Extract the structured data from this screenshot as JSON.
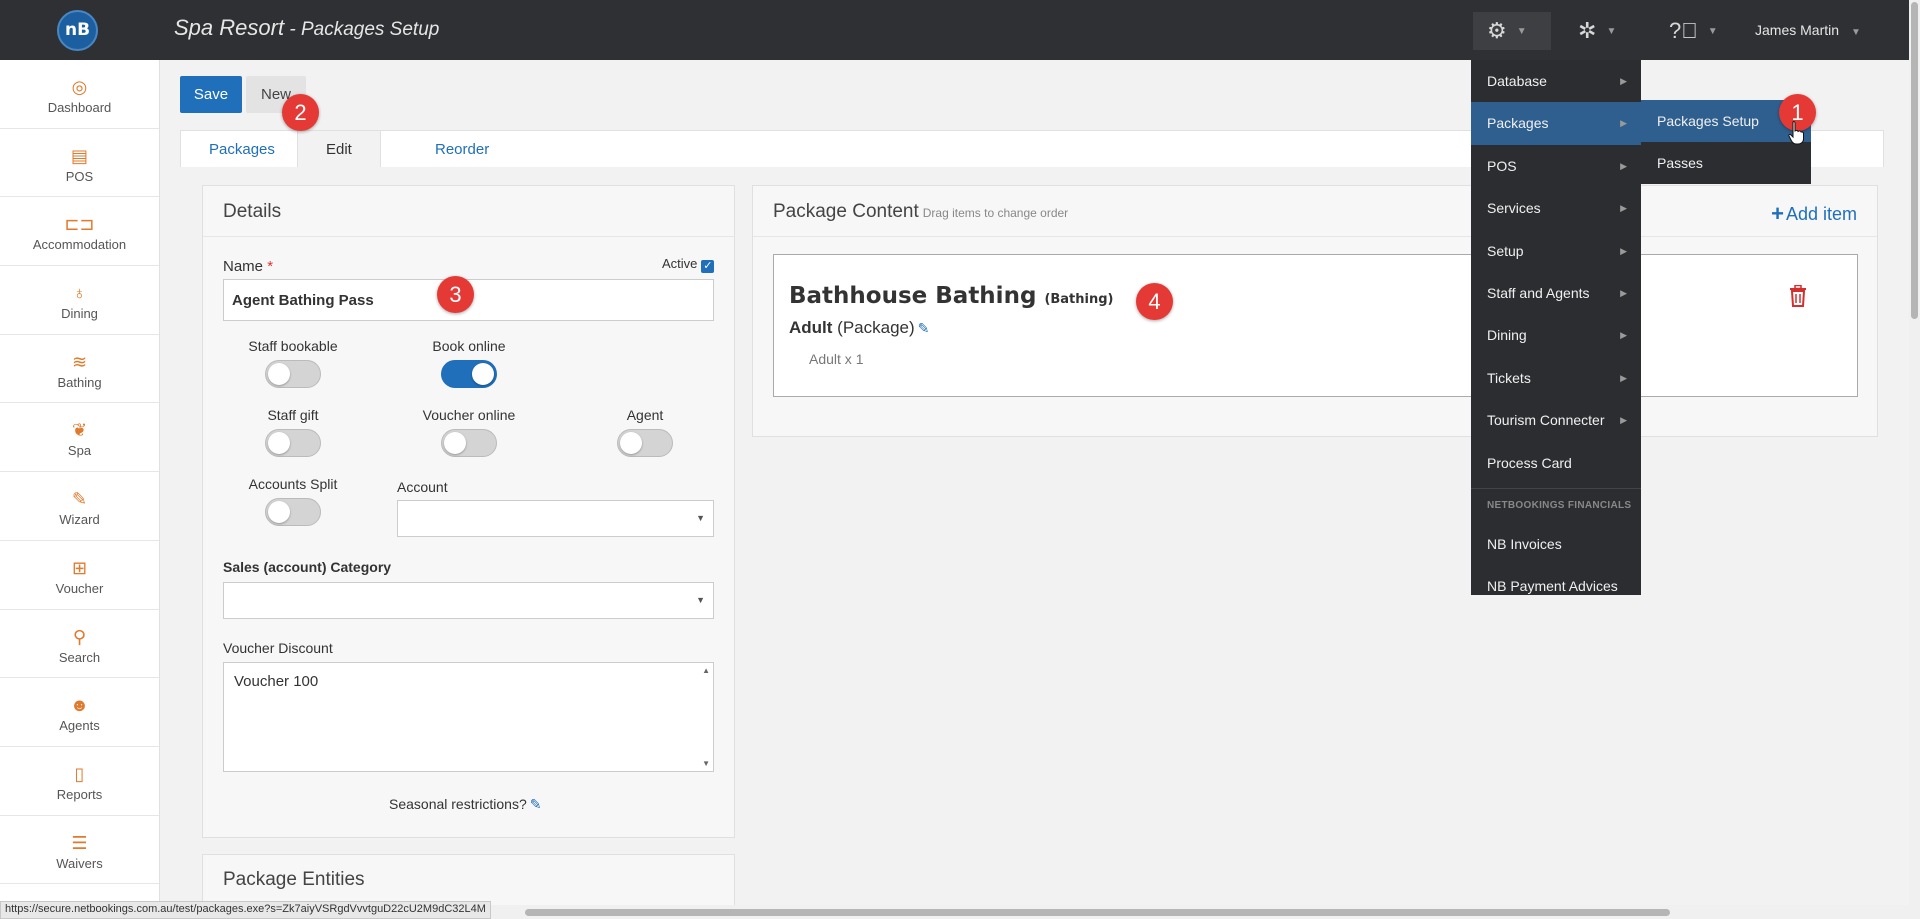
{
  "header": {
    "logo_text": "nB",
    "title_main": "Spa Resort",
    "title_sep": " - ",
    "title_sub": "Packages Setup",
    "user_name": "James Martin",
    "icons": [
      "gears-icon",
      "puzzle-icon",
      "help-circle-icon"
    ]
  },
  "sidebar": {
    "items": [
      {
        "label": "Dashboard",
        "icon": "dashboard-icon"
      },
      {
        "label": "POS",
        "icon": "pos-icon"
      },
      {
        "label": "Accommodation",
        "icon": "bed-icon"
      },
      {
        "label": "Dining",
        "icon": "dining-icon"
      },
      {
        "label": "Bathing",
        "icon": "waves-icon"
      },
      {
        "label": "Spa",
        "icon": "lotus-icon"
      },
      {
        "label": "Wizard",
        "icon": "wand-icon"
      },
      {
        "label": "Voucher",
        "icon": "gift-icon"
      },
      {
        "label": "Search",
        "icon": "search-icon"
      },
      {
        "label": "Agents",
        "icon": "agents-icon"
      },
      {
        "label": "Reports",
        "icon": "document-icon"
      },
      {
        "label": "Waivers",
        "icon": "checklist-icon"
      }
    ]
  },
  "toolbar": {
    "save_label": "Save",
    "new_label": "New"
  },
  "tabs": [
    {
      "label": "Packages"
    },
    {
      "label": "Edit"
    },
    {
      "label": "Reorder"
    }
  ],
  "details": {
    "title": "Details",
    "name_label": "Name",
    "required_mark": "*",
    "active_label": "Active",
    "active_checked": true,
    "name_value": "Agent Bathing Pass",
    "toggles": {
      "staff_bookable": {
        "label": "Staff bookable",
        "on": false
      },
      "book_online": {
        "label": "Book online",
        "on": true
      },
      "staff_gift": {
        "label": "Staff gift",
        "on": false
      },
      "voucher_online": {
        "label": "Voucher online",
        "on": false
      },
      "agent": {
        "label": "Agent",
        "on": false
      },
      "accounts_split": {
        "label": "Accounts Split",
        "on": false
      }
    },
    "account_label": "Account",
    "account_value": "",
    "sales_category_label": "Sales (account) Category",
    "sales_category_value": "",
    "voucher_discount_label": "Voucher Discount",
    "voucher_discount_value": "Voucher 100",
    "seasonal_label": "Seasonal restrictions?"
  },
  "entities": {
    "title": "Package Entities"
  },
  "package_content": {
    "title": "Package Content",
    "hint": "Drag items to change order",
    "add_item_label": "Add item",
    "item": {
      "name": "Bathhouse Bathing",
      "category": "(Bathing)",
      "type_label": "Adult",
      "type_kind": "(Package)",
      "quantity_text": "Adult x 1"
    }
  },
  "menu": {
    "items": [
      {
        "label": "Database",
        "has_sub": true
      },
      {
        "label": "Packages",
        "has_sub": true,
        "active": true
      },
      {
        "label": "POS",
        "has_sub": true
      },
      {
        "label": "Services",
        "has_sub": true
      },
      {
        "label": "Setup",
        "has_sub": true
      },
      {
        "label": "Staff and Agents",
        "has_sub": true
      },
      {
        "label": "Dining",
        "has_sub": true
      },
      {
        "label": "Tickets",
        "has_sub": true
      },
      {
        "label": "Tourism Connecter",
        "has_sub": true
      },
      {
        "label": "Process Card",
        "has_sub": false
      }
    ],
    "section_label": "NETBOOKINGS FINANCIALS",
    "section_items": [
      {
        "label": "NB Invoices"
      },
      {
        "label": "NB Payment Advices"
      }
    ],
    "submenu": [
      {
        "label": "Packages Setup",
        "active": true
      },
      {
        "label": "Passes"
      }
    ]
  },
  "badges": [
    "1",
    "2",
    "3",
    "4"
  ],
  "status_url": "https://secure.netbookings.com.au/test/packages.exe?s=Zk7aiyVSRgdVvvtguD22cU2M9dC32L4M",
  "colors": {
    "accent": "#1f6fba",
    "topbar": "#2e3033",
    "sidebar_icon": "#e07a2e",
    "badge": "#e53935",
    "trash": "#d32f2f"
  }
}
